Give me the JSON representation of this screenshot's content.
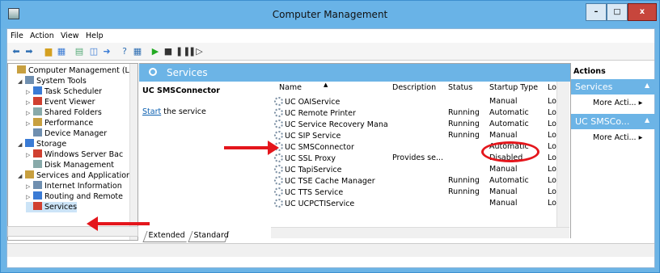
{
  "window": {
    "title": "Computer Management"
  },
  "menu": [
    "File",
    "Action",
    "View",
    "Help"
  ],
  "tree": [
    {
      "label": "Computer Management (Lo",
      "indent": 0,
      "exp": ""
    },
    {
      "label": "System Tools",
      "indent": 1,
      "exp": "◢"
    },
    {
      "label": "Task Scheduler",
      "indent": 2,
      "exp": "▷"
    },
    {
      "label": "Event Viewer",
      "indent": 2,
      "exp": "▷"
    },
    {
      "label": "Shared Folders",
      "indent": 2,
      "exp": "▷"
    },
    {
      "label": "Performance",
      "indent": 2,
      "exp": "▷"
    },
    {
      "label": "Device Manager",
      "indent": 2,
      "exp": ""
    },
    {
      "label": "Storage",
      "indent": 1,
      "exp": "◢"
    },
    {
      "label": "Windows Server Bac",
      "indent": 2,
      "exp": "▷"
    },
    {
      "label": "Disk Management",
      "indent": 2,
      "exp": ""
    },
    {
      "label": "Services and Application",
      "indent": 1,
      "exp": "◢"
    },
    {
      "label": "Internet Information",
      "indent": 2,
      "exp": "▷"
    },
    {
      "label": "Routing and Remote",
      "indent": 2,
      "exp": "▷"
    },
    {
      "label": "Services",
      "indent": 2,
      "exp": ""
    }
  ],
  "services_panel": {
    "header": "Services",
    "selected_name": "UC SMSConnector",
    "start_link": "Start",
    "start_rest": " the service"
  },
  "columns": [
    "Name",
    "Description",
    "Status",
    "Startup Type",
    "Lo"
  ],
  "rows": [
    {
      "name": "UC OAIService",
      "description": "",
      "status": "",
      "startup": "Manual",
      "logon": "Lo"
    },
    {
      "name": "UC Remote Printer",
      "description": "",
      "status": "Running",
      "startup": "Automatic",
      "logon": "Lo"
    },
    {
      "name": "UC Service Recovery Manag...",
      "description": "",
      "status": "Running",
      "startup": "Automatic",
      "logon": "Lo"
    },
    {
      "name": "UC SIP Service",
      "description": "",
      "status": "Running",
      "startup": "Manual",
      "logon": "Lo"
    },
    {
      "name": "UC SMSConnector",
      "description": "",
      "status": "",
      "startup": "Automatic",
      "logon": "Lo"
    },
    {
      "name": "UC SSL Proxy",
      "description": "Provides se...",
      "status": "",
      "startup": "Disabled",
      "logon": "Lo"
    },
    {
      "name": "UC TapiService",
      "description": "",
      "status": "",
      "startup": "Manual",
      "logon": "Lo"
    },
    {
      "name": "UC TSE Cache Manager",
      "description": "",
      "status": "Running",
      "startup": "Automatic",
      "logon": "Lo"
    },
    {
      "name": "UC TTS Service",
      "description": "",
      "status": "Running",
      "startup": "Manual",
      "logon": "Lo"
    },
    {
      "name": "UC UCPCTIService",
      "description": "",
      "status": "",
      "startup": "Manual",
      "logon": "Lo"
    }
  ],
  "tabs": [
    "Extended",
    "Standard"
  ],
  "actions": {
    "title": "Actions",
    "section1": "Services",
    "section1_more": "More Acti...",
    "section2": "UC SMSCo...",
    "section2_more": "More Acti..."
  },
  "colors": {
    "accent": "#6cb4e6",
    "annotation": "#e4161c"
  }
}
